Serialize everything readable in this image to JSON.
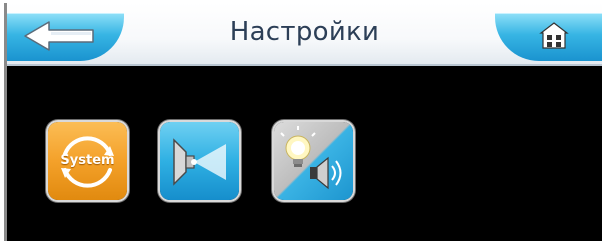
{
  "header": {
    "title": "Настройки",
    "back_icon": "back-arrow-icon",
    "home_icon": "home-icon"
  },
  "tiles": [
    {
      "id": "system",
      "label": "System",
      "icon": "system-icon"
    },
    {
      "id": "projector",
      "icon": "projector-icon"
    },
    {
      "id": "light-sound",
      "icon": "light-sound-icon"
    }
  ],
  "colors": {
    "accent_blue": "#2fb0e3",
    "system_orange": "#f4a12a",
    "background": "#000000",
    "header_text": "#2c3f57"
  }
}
